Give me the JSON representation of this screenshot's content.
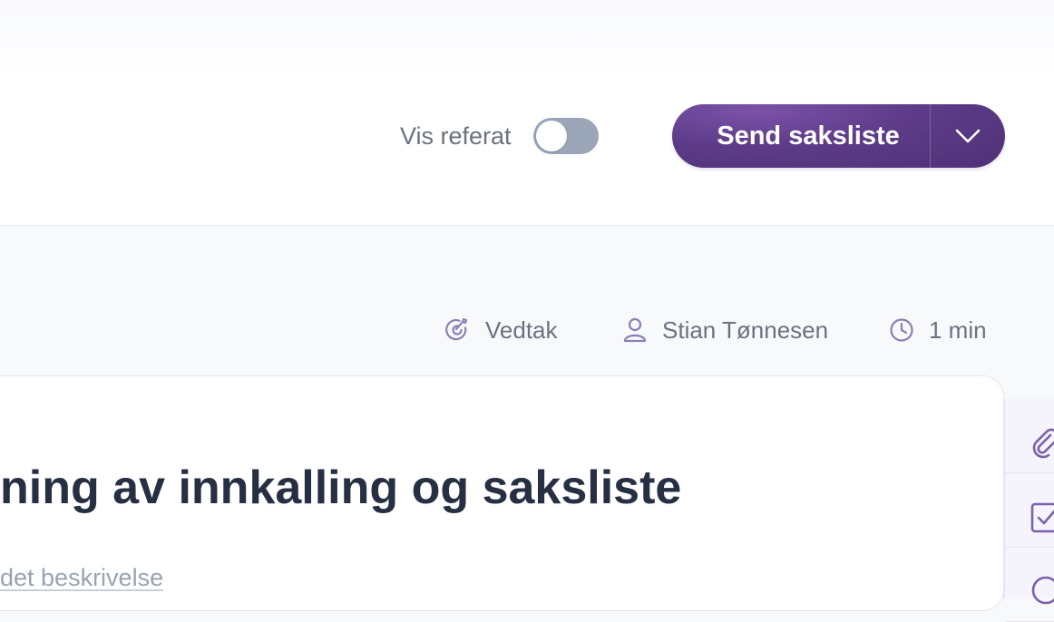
{
  "header": {
    "toggle_label": "Vis referat",
    "toggle_on": false,
    "send_label": "Send saksliste"
  },
  "meta": {
    "type": "Vedtak",
    "owner": "Stian Tønnesen",
    "duration": "1 min"
  },
  "item": {
    "title": "ning av innkalling og saksliste",
    "description": "det beskrivelse"
  },
  "icons": {
    "type": "target-check-icon",
    "owner": "user-icon",
    "duration": "clock-icon",
    "caret": "chevron-down-icon",
    "rail": [
      "paperclip-icon",
      "checkbox-icon",
      "circle-icon"
    ]
  },
  "colors": {
    "accent": "#5d3b88",
    "toggle_off": "#9aa6b8",
    "title": "#263042"
  }
}
